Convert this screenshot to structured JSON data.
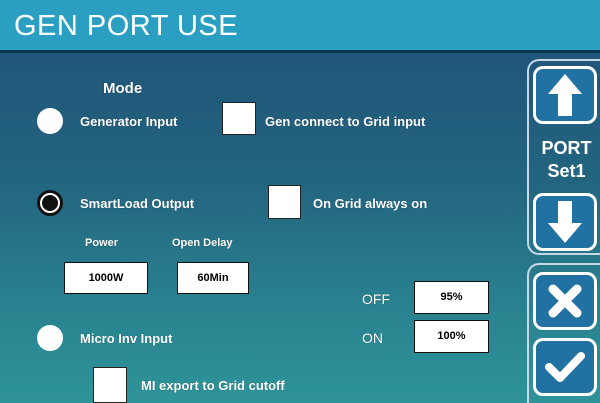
{
  "header": {
    "title": "GEN PORT USE"
  },
  "mode": {
    "label": "Mode",
    "options": [
      {
        "label": "Generator Input",
        "selected": false
      },
      {
        "label": "SmartLoad Output",
        "selected": true
      },
      {
        "label": "Micro Inv Input",
        "selected": false
      }
    ]
  },
  "checkboxes": {
    "gen_connect": "Gen connect to Grid input",
    "on_grid": "On Grid always on",
    "mi_export": "MI export to Grid cutoff"
  },
  "smartload": {
    "power_label": "Power",
    "power_value": "1000W",
    "delay_label": "Open Delay",
    "delay_value": "60Min"
  },
  "micro": {
    "off_label": "OFF",
    "off_value": "95%",
    "on_label": "ON",
    "on_value": "100%"
  },
  "side": {
    "port_line1": "PORT",
    "port_line2": "Set1"
  },
  "icons": [
    "arrow-up-icon",
    "arrow-down-icon",
    "close-icon",
    "check-icon"
  ],
  "colors": {
    "title_bar": "#2a9fc1",
    "button_fill": "#2172a3"
  }
}
